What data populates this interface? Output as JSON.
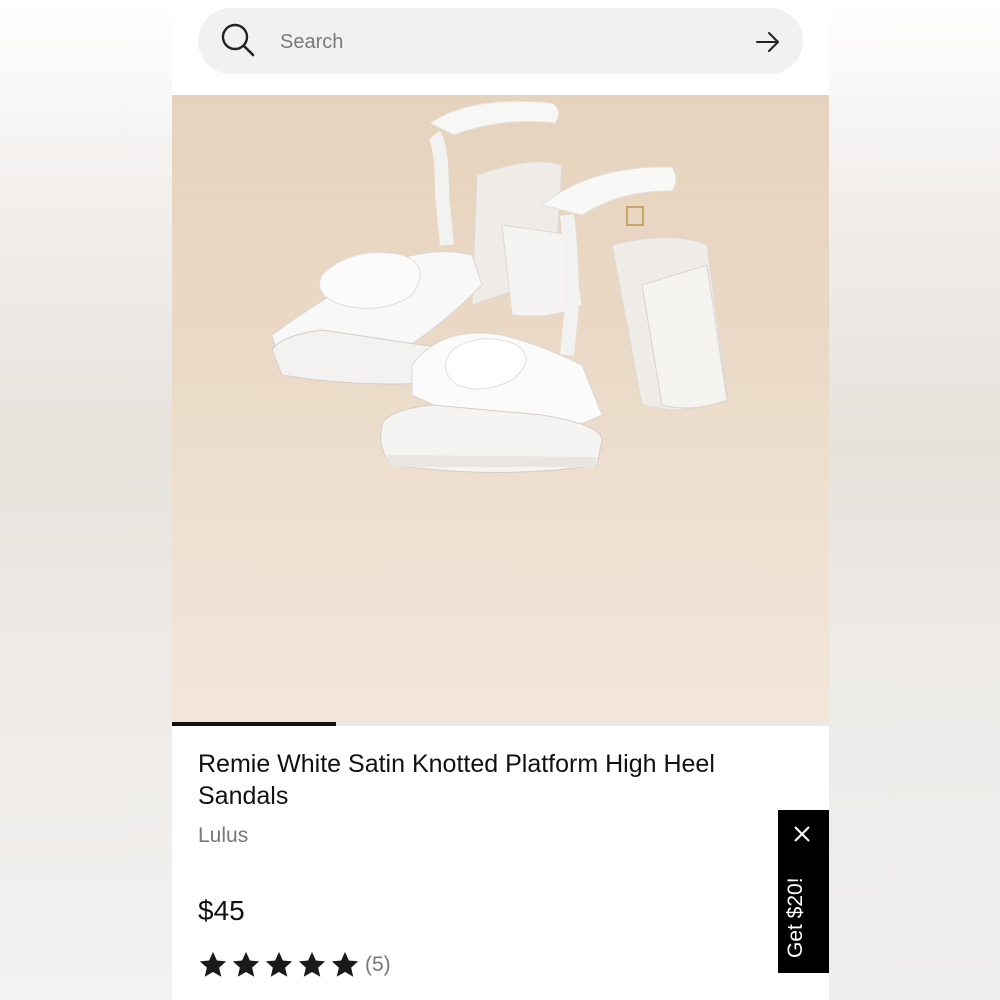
{
  "search": {
    "placeholder": "Search"
  },
  "product": {
    "title": "Remie White Satin Knotted Platform High Heel Sandals",
    "brand": "Lulus",
    "price": "$45",
    "rating": 5,
    "review_count": "(5)",
    "image_description_icon": "sandals-image",
    "gallery_progress": 0.25
  },
  "promo": {
    "label": "Get $20!"
  },
  "colors": {
    "accent": "#111111",
    "promo_bg": "#000000",
    "search_bg": "#f1f1f1",
    "image_bg": "#e9d8c5"
  }
}
